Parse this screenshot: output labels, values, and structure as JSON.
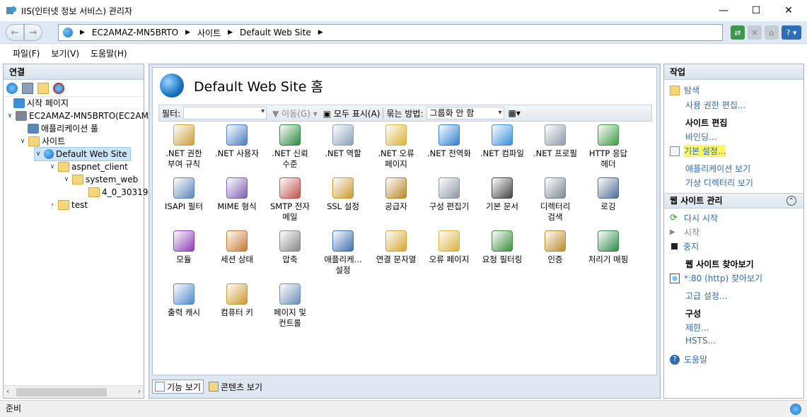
{
  "window": {
    "title": "IIS(인터넷 정보 서비스) 관리자",
    "minimize": "—",
    "maximize": "☐",
    "close": "✕"
  },
  "address": {
    "crumbs": [
      "EC2AMAZ-MN5BRTO",
      "사이트",
      "Default Web Site"
    ]
  },
  "menu": [
    "파일(F)",
    "보기(V)",
    "도움말(H)"
  ],
  "connections": {
    "title": "연결",
    "tree": [
      {
        "label": "시작 페이지"
      },
      {
        "label": "EC2AMAZ-MN5BRTO(EC2AM"
      },
      {
        "label": "애플리케이션 풀"
      },
      {
        "label": "사이트"
      },
      {
        "label": "Default Web Site"
      },
      {
        "label": "aspnet_client"
      },
      {
        "label": "system_web"
      },
      {
        "label": "4_0_30319"
      },
      {
        "label": "test"
      }
    ]
  },
  "main": {
    "title": "Default Web Site 홈",
    "filter_label": "필터:",
    "go_label": "이동(G)",
    "show_all_label": "모두 표시(A)",
    "group_label": "묶는 방법:",
    "group_value": "그룹화 안 함",
    "features": [
      {
        "label": ".NET 권한\n부여 규칙",
        "icon": "lock-users-icon",
        "color": "#c9a03a"
      },
      {
        "label": ".NET 사용자",
        "icon": "user-icon",
        "color": "#4a7fc1"
      },
      {
        "label": ".NET 신뢰\n수준",
        "icon": "globe-check-icon",
        "color": "#2b8a3e"
      },
      {
        "label": ".NET 역할",
        "icon": "roles-icon",
        "color": "#8aa0b8"
      },
      {
        "label": ".NET 오류\n페이지",
        "icon": "error-404-icon",
        "color": "#d9b13b"
      },
      {
        "label": ".NET 전역화",
        "icon": "globe-icon",
        "color": "#2f7fcf"
      },
      {
        "label": ".NET 컴파일",
        "icon": "compile-icon",
        "color": "#3a8fd8"
      },
      {
        "label": ".NET 프로필",
        "icon": "profile-icon",
        "color": "#8f9aa8"
      },
      {
        "label": "HTTP 응답\n헤더",
        "icon": "http-headers-icon",
        "color": "#3f9a46"
      },
      {
        "label": "ISAPI 필터",
        "icon": "filter-icon",
        "color": "#5b86b8"
      },
      {
        "label": "MIME 형식",
        "icon": "mime-icon",
        "color": "#7b5fb0"
      },
      {
        "label": "SMTP 전자\n메일",
        "icon": "smtp-icon",
        "color": "#c0504d"
      },
      {
        "label": "SSL 설정",
        "icon": "padlock-icon",
        "color": "#c99a2e"
      },
      {
        "label": "공급자",
        "icon": "provider-icon",
        "color": "#b7862a"
      },
      {
        "label": "구성 편집기",
        "icon": "config-editor-icon",
        "color": "#8c97a3"
      },
      {
        "label": "기본 문서",
        "icon": "default-document-icon",
        "color": "#444444"
      },
      {
        "label": "디렉터리\n검색",
        "icon": "directory-browse-icon",
        "color": "#7d8793"
      },
      {
        "label": "로깅",
        "icon": "logging-icon",
        "color": "#4e6c95"
      },
      {
        "label": "모듈",
        "icon": "modules-icon",
        "color": "#8b3bb3"
      },
      {
        "label": "세션 상태",
        "icon": "session-icon",
        "color": "#c87a2f"
      },
      {
        "label": "압축",
        "icon": "compression-icon",
        "color": "#888888"
      },
      {
        "label": "애플리케...\n설정",
        "icon": "app-settings-icon",
        "color": "#3c6fae"
      },
      {
        "label": "연결 문자열",
        "icon": "connection-strings-icon",
        "color": "#d8a630"
      },
      {
        "label": "오류 페이지",
        "icon": "error-pages-icon",
        "color": "#d9b13b"
      },
      {
        "label": "요청 필터링",
        "icon": "request-filtering-icon",
        "color": "#3b8e3f"
      },
      {
        "label": "인증",
        "icon": "authentication-icon",
        "color": "#b98a2b"
      },
      {
        "label": "처리기 매핑",
        "icon": "handler-mappings-icon",
        "color": "#2f8a4a"
      },
      {
        "label": "출력 캐시",
        "icon": "output-cache-icon",
        "color": "#4f8ac9"
      },
      {
        "label": "컴퓨터 키",
        "icon": "machine-key-icon",
        "color": "#c99a2e"
      },
      {
        "label": "페이지 및\n컨트롤",
        "icon": "pages-controls-icon",
        "color": "#6b8fb8"
      }
    ],
    "tabs": [
      "기능 보기",
      "콘텐츠 보기"
    ]
  },
  "actions": {
    "title": "작업",
    "explore": "탐색",
    "edit_permissions": "사용 권한 편집...",
    "edit_site_heading": "사이트 편집",
    "bindings": "바인딩...",
    "basic_settings": "기본 설정...",
    "view_applications": "애플리케이션 보기",
    "view_vdirs": "가상 디렉터리 보기",
    "manage_site_heading": "웹 사이트 관리",
    "restart": "다시 시작",
    "start": "시작",
    "stop": "중지",
    "browse_heading": "웹 사이트 찾아보기",
    "browse_80": "*:80 (http) 찾아보기",
    "advanced_settings": "고급 설정...",
    "config_heading": "구성",
    "limits": "제한...",
    "hsts": "HSTS...",
    "help": "도움말"
  },
  "status": {
    "text": "준비"
  }
}
